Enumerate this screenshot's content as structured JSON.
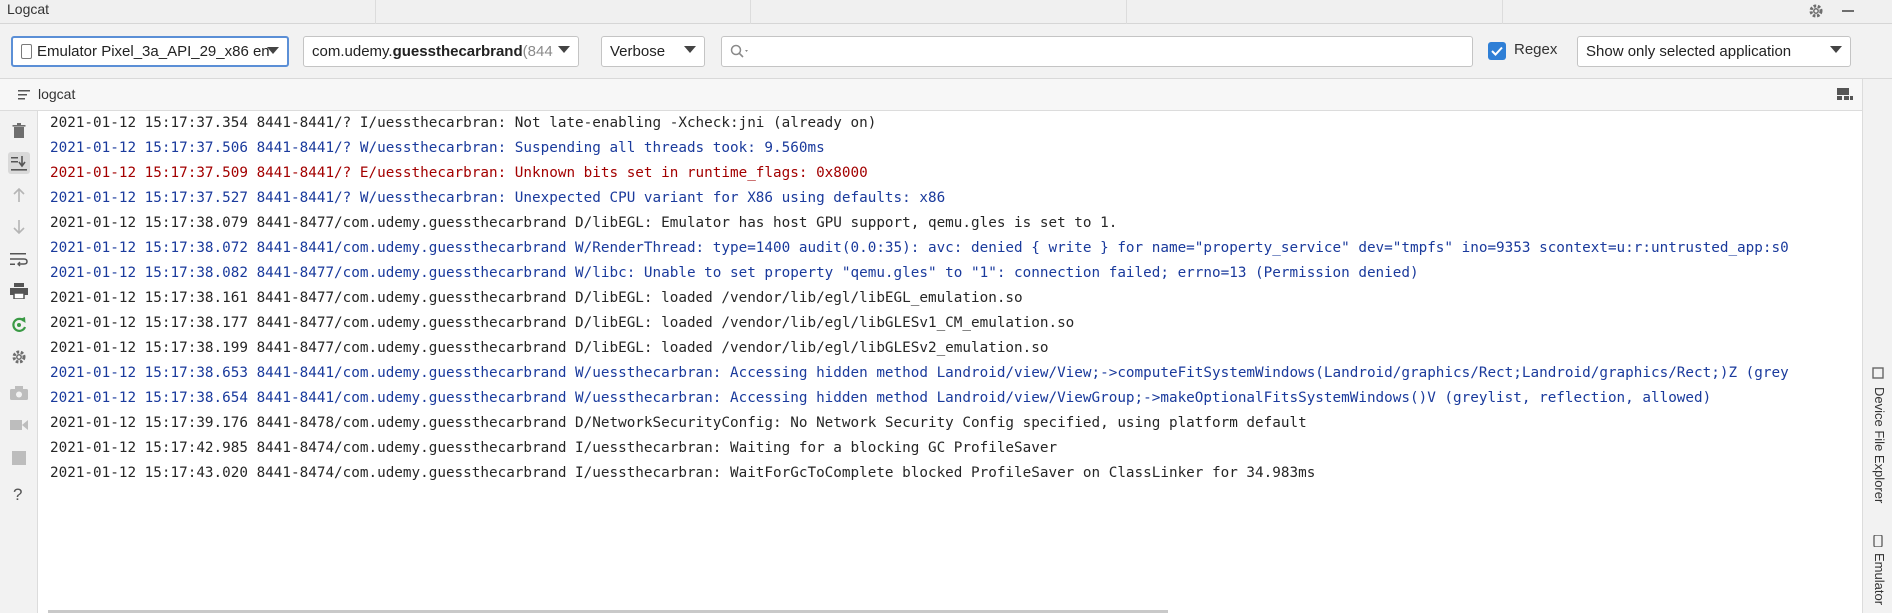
{
  "window": {
    "title": "Logcat"
  },
  "toolbar": {
    "device": "Emulator Pixel_3a_API_29_x86 en",
    "process_prefix": "com.udemy.",
    "process_bold": "guessthecarbrand",
    "process_pid": " (844",
    "log_level": "Verbose",
    "search_value": "",
    "regex_label": "Regex",
    "regex_checked": true,
    "filter": "Show only selected application"
  },
  "tab": {
    "label": "logcat"
  },
  "left_toolbar": {
    "icons": [
      "trash-icon",
      "scroll-to-end-icon",
      "up-arrow-icon",
      "down-arrow-icon",
      "soft-wrap-icon",
      "print-icon",
      "restart-icon",
      "settings-icon",
      "camera-icon",
      "video-icon",
      "stop-icon",
      "help-icon"
    ]
  },
  "log": {
    "lines": [
      {
        "text": "2021-01-12 15:17:37.354 8441-8441/? I/uessthecarbran: Not late-enabling -Xcheck:jni (already on)",
        "level": "I"
      },
      {
        "text": "2021-01-12 15:17:37.506 8441-8441/? W/uessthecarbran: Suspending all threads took: 9.560ms",
        "level": "W"
      },
      {
        "text": "2021-01-12 15:17:37.509 8441-8441/? E/uessthecarbran: Unknown bits set in runtime_flags: 0x8000",
        "level": "E"
      },
      {
        "text": "2021-01-12 15:17:37.527 8441-8441/? W/uessthecarbran: Unexpected CPU variant for X86 using defaults: x86",
        "level": "W"
      },
      {
        "text": "2021-01-12 15:17:38.079 8441-8477/com.udemy.guessthecarbrand D/libEGL: Emulator has host GPU support, qemu.gles is set to 1.",
        "level": "D"
      },
      {
        "text": "2021-01-12 15:17:38.072 8441-8441/com.udemy.guessthecarbrand W/RenderThread: type=1400 audit(0.0:35): avc: denied { write } for name=\"property_service\" dev=\"tmpfs\" ino=9353 scontext=u:r:untrusted_app:s0",
        "level": "W"
      },
      {
        "text": "2021-01-12 15:17:38.082 8441-8477/com.udemy.guessthecarbrand W/libc: Unable to set property \"qemu.gles\" to \"1\": connection failed; errno=13 (Permission denied)",
        "level": "W"
      },
      {
        "text": "2021-01-12 15:17:38.161 8441-8477/com.udemy.guessthecarbrand D/libEGL: loaded /vendor/lib/egl/libEGL_emulation.so",
        "level": "D"
      },
      {
        "text": "2021-01-12 15:17:38.177 8441-8477/com.udemy.guessthecarbrand D/libEGL: loaded /vendor/lib/egl/libGLESv1_CM_emulation.so",
        "level": "D"
      },
      {
        "text": "2021-01-12 15:17:38.199 8441-8477/com.udemy.guessthecarbrand D/libEGL: loaded /vendor/lib/egl/libGLESv2_emulation.so",
        "level": "D"
      },
      {
        "text": "2021-01-12 15:17:38.653 8441-8441/com.udemy.guessthecarbrand W/uessthecarbran: Accessing hidden method Landroid/view/View;->computeFitSystemWindows(Landroid/graphics/Rect;Landroid/graphics/Rect;)Z (grey",
        "level": "W"
      },
      {
        "text": "2021-01-12 15:17:38.654 8441-8441/com.udemy.guessthecarbrand W/uessthecarbran: Accessing hidden method Landroid/view/ViewGroup;->makeOptionalFitsSystemWindows()V (greylist, reflection, allowed)",
        "level": "W"
      },
      {
        "text": "2021-01-12 15:17:39.176 8441-8478/com.udemy.guessthecarbrand D/NetworkSecurityConfig: No Network Security Config specified, using platform default",
        "level": "D"
      },
      {
        "text": "2021-01-12 15:17:42.985 8441-8474/com.udemy.guessthecarbrand I/uessthecarbran: Waiting for a blocking GC ProfileSaver",
        "level": "I"
      },
      {
        "text": "2021-01-12 15:17:43.020 8441-8474/com.udemy.guessthecarbrand I/uessthecarbran: WaitForGcToComplete blocked ProfileSaver on ClassLinker for 34.983ms",
        "level": "I"
      }
    ]
  },
  "right_panel": {
    "device_file_explorer": "Device File Explorer",
    "emulator": "Emulator"
  },
  "colors": {
    "warning": "#1a3a9c",
    "error": "#a30000",
    "info": "#262626",
    "accent": "#2f7fd6"
  }
}
